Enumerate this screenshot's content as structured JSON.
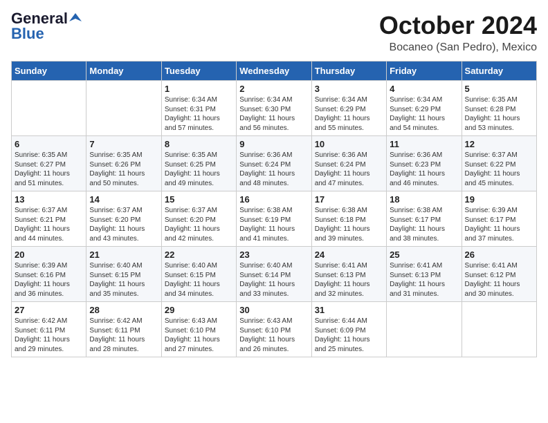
{
  "header": {
    "logo_general": "General",
    "logo_blue": "Blue",
    "month": "October 2024",
    "location": "Bocaneo (San Pedro), Mexico"
  },
  "days_of_week": [
    "Sunday",
    "Monday",
    "Tuesday",
    "Wednesday",
    "Thursday",
    "Friday",
    "Saturday"
  ],
  "weeks": [
    [
      {
        "day": "",
        "info": ""
      },
      {
        "day": "",
        "info": ""
      },
      {
        "day": "1",
        "info": "Sunrise: 6:34 AM\nSunset: 6:31 PM\nDaylight: 11 hours\nand 57 minutes."
      },
      {
        "day": "2",
        "info": "Sunrise: 6:34 AM\nSunset: 6:30 PM\nDaylight: 11 hours\nand 56 minutes."
      },
      {
        "day": "3",
        "info": "Sunrise: 6:34 AM\nSunset: 6:29 PM\nDaylight: 11 hours\nand 55 minutes."
      },
      {
        "day": "4",
        "info": "Sunrise: 6:34 AM\nSunset: 6:29 PM\nDaylight: 11 hours\nand 54 minutes."
      },
      {
        "day": "5",
        "info": "Sunrise: 6:35 AM\nSunset: 6:28 PM\nDaylight: 11 hours\nand 53 minutes."
      }
    ],
    [
      {
        "day": "6",
        "info": "Sunrise: 6:35 AM\nSunset: 6:27 PM\nDaylight: 11 hours\nand 51 minutes."
      },
      {
        "day": "7",
        "info": "Sunrise: 6:35 AM\nSunset: 6:26 PM\nDaylight: 11 hours\nand 50 minutes."
      },
      {
        "day": "8",
        "info": "Sunrise: 6:35 AM\nSunset: 6:25 PM\nDaylight: 11 hours\nand 49 minutes."
      },
      {
        "day": "9",
        "info": "Sunrise: 6:36 AM\nSunset: 6:24 PM\nDaylight: 11 hours\nand 48 minutes."
      },
      {
        "day": "10",
        "info": "Sunrise: 6:36 AM\nSunset: 6:24 PM\nDaylight: 11 hours\nand 47 minutes."
      },
      {
        "day": "11",
        "info": "Sunrise: 6:36 AM\nSunset: 6:23 PM\nDaylight: 11 hours\nand 46 minutes."
      },
      {
        "day": "12",
        "info": "Sunrise: 6:37 AM\nSunset: 6:22 PM\nDaylight: 11 hours\nand 45 minutes."
      }
    ],
    [
      {
        "day": "13",
        "info": "Sunrise: 6:37 AM\nSunset: 6:21 PM\nDaylight: 11 hours\nand 44 minutes."
      },
      {
        "day": "14",
        "info": "Sunrise: 6:37 AM\nSunset: 6:20 PM\nDaylight: 11 hours\nand 43 minutes."
      },
      {
        "day": "15",
        "info": "Sunrise: 6:37 AM\nSunset: 6:20 PM\nDaylight: 11 hours\nand 42 minutes."
      },
      {
        "day": "16",
        "info": "Sunrise: 6:38 AM\nSunset: 6:19 PM\nDaylight: 11 hours\nand 41 minutes."
      },
      {
        "day": "17",
        "info": "Sunrise: 6:38 AM\nSunset: 6:18 PM\nDaylight: 11 hours\nand 39 minutes."
      },
      {
        "day": "18",
        "info": "Sunrise: 6:38 AM\nSunset: 6:17 PM\nDaylight: 11 hours\nand 38 minutes."
      },
      {
        "day": "19",
        "info": "Sunrise: 6:39 AM\nSunset: 6:17 PM\nDaylight: 11 hours\nand 37 minutes."
      }
    ],
    [
      {
        "day": "20",
        "info": "Sunrise: 6:39 AM\nSunset: 6:16 PM\nDaylight: 11 hours\nand 36 minutes."
      },
      {
        "day": "21",
        "info": "Sunrise: 6:40 AM\nSunset: 6:15 PM\nDaylight: 11 hours\nand 35 minutes."
      },
      {
        "day": "22",
        "info": "Sunrise: 6:40 AM\nSunset: 6:15 PM\nDaylight: 11 hours\nand 34 minutes."
      },
      {
        "day": "23",
        "info": "Sunrise: 6:40 AM\nSunset: 6:14 PM\nDaylight: 11 hours\nand 33 minutes."
      },
      {
        "day": "24",
        "info": "Sunrise: 6:41 AM\nSunset: 6:13 PM\nDaylight: 11 hours\nand 32 minutes."
      },
      {
        "day": "25",
        "info": "Sunrise: 6:41 AM\nSunset: 6:13 PM\nDaylight: 11 hours\nand 31 minutes."
      },
      {
        "day": "26",
        "info": "Sunrise: 6:41 AM\nSunset: 6:12 PM\nDaylight: 11 hours\nand 30 minutes."
      }
    ],
    [
      {
        "day": "27",
        "info": "Sunrise: 6:42 AM\nSunset: 6:11 PM\nDaylight: 11 hours\nand 29 minutes."
      },
      {
        "day": "28",
        "info": "Sunrise: 6:42 AM\nSunset: 6:11 PM\nDaylight: 11 hours\nand 28 minutes."
      },
      {
        "day": "29",
        "info": "Sunrise: 6:43 AM\nSunset: 6:10 PM\nDaylight: 11 hours\nand 27 minutes."
      },
      {
        "day": "30",
        "info": "Sunrise: 6:43 AM\nSunset: 6:10 PM\nDaylight: 11 hours\nand 26 minutes."
      },
      {
        "day": "31",
        "info": "Sunrise: 6:44 AM\nSunset: 6:09 PM\nDaylight: 11 hours\nand 25 minutes."
      },
      {
        "day": "",
        "info": ""
      },
      {
        "day": "",
        "info": ""
      }
    ]
  ]
}
